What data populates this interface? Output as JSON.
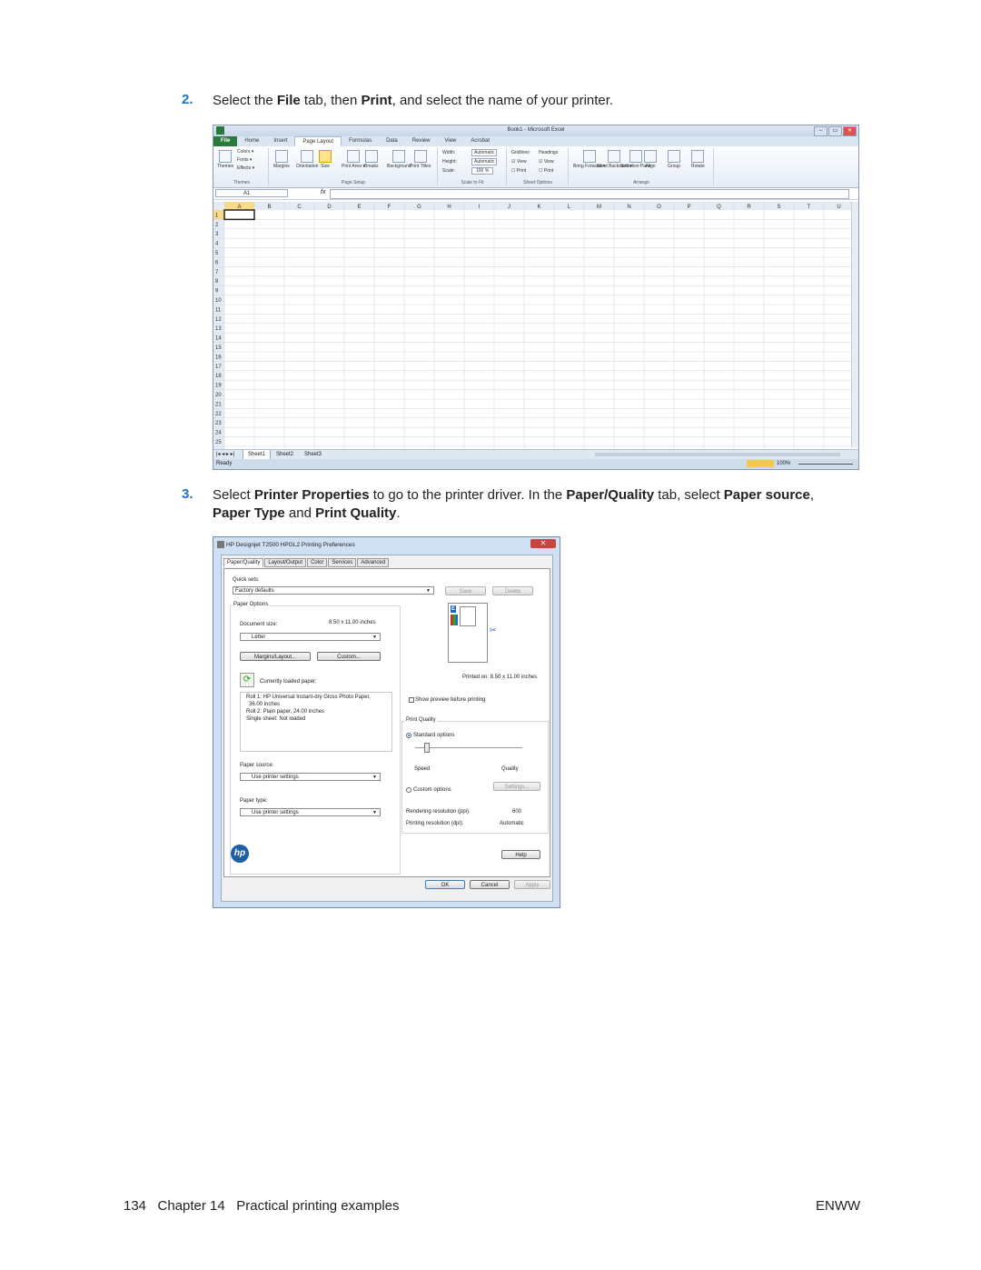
{
  "steps": [
    {
      "number": "2.",
      "segments": [
        {
          "text": "Select the ",
          "bold": false
        },
        {
          "text": "File",
          "bold": true
        },
        {
          "text": " tab, then ",
          "bold": false
        },
        {
          "text": "Print",
          "bold": true
        },
        {
          "text": ", and select the name of your printer.",
          "bold": false
        }
      ]
    },
    {
      "number": "3.",
      "segments": [
        {
          "text": "Select ",
          "bold": false
        },
        {
          "text": "Printer Properties",
          "bold": true
        },
        {
          "text": " to go to the printer driver. In the ",
          "bold": false
        },
        {
          "text": "Paper/Quality",
          "bold": true
        },
        {
          "text": " tab, select ",
          "bold": false
        },
        {
          "text": "Paper source",
          "bold": true
        },
        {
          "text": ",",
          "bold": false
        },
        {
          "text": "Paper Type",
          "bold": true,
          "newline": true
        },
        {
          "text": " and ",
          "bold": false
        },
        {
          "text": "Print Quality",
          "bold": true
        },
        {
          "text": ".",
          "bold": false
        }
      ]
    }
  ],
  "excel": {
    "title": "Book1 - Microsoft Excel",
    "window_buttons": [
      "–",
      "▭",
      "✕"
    ],
    "tabs": [
      "File",
      "Home",
      "Insert",
      "Page Layout",
      "Formulas",
      "Data",
      "Review",
      "View",
      "Acrobat"
    ],
    "ribbon": {
      "themes": {
        "items": [
          "Colors ▾",
          "Fonts ▾",
          "Effects ▾"
        ],
        "themes_label": "Themes",
        "group": "Themes"
      },
      "page_setup": {
        "items": [
          "Margins",
          "Orientation",
          "Size",
          "Print Area ▾",
          "Breaks",
          "Background",
          "Print Titles"
        ],
        "group": "Page Setup"
      },
      "scale": {
        "width_label": "Width:",
        "width_value": "Automatic",
        "height_label": "Height:",
        "height_value": "Automatic",
        "scale_label": "Scale:",
        "scale_value": "100 %",
        "group": "Scale to Fit"
      },
      "sheet_options": {
        "gridlines": "Gridlines",
        "headings": "Headings",
        "view": "View",
        "print": "Print",
        "group": "Sheet Options"
      },
      "arrange": {
        "items": [
          "Bring Forward ▾",
          "Send Backward ▾",
          "Selection Pane",
          "Align",
          "Group",
          "Rotate"
        ],
        "group": "Arrange"
      }
    },
    "name_box": "A1",
    "fx": "fx",
    "columns": [
      "A",
      "B",
      "C",
      "D",
      "E",
      "F",
      "G",
      "H",
      "I",
      "J",
      "K",
      "L",
      "M",
      "N",
      "O",
      "P",
      "Q",
      "R",
      "S",
      "T",
      "U"
    ],
    "rows": [
      "1",
      "2",
      "3",
      "4",
      "5",
      "6",
      "7",
      "8",
      "9",
      "10",
      "11",
      "12",
      "13",
      "14",
      "15",
      "16",
      "17",
      "18",
      "19",
      "20",
      "21",
      "22",
      "23",
      "24",
      "25"
    ],
    "sheets": [
      "Sheet1",
      "Sheet2",
      "Sheet3"
    ],
    "status": "Ready",
    "zoom": "100%"
  },
  "dialog": {
    "title": "HP Designjet T2500 HPGL2 Printing Preferences",
    "close": "✕",
    "tabs": [
      "Paper/Quality",
      "Layout/Output",
      "Color",
      "Services",
      "Advanced"
    ],
    "quick_sets_label": "Quick sets:",
    "quick_sets_value": "Factory defaults",
    "save": "Save",
    "delete": "Delete",
    "paper_options": "Paper Options",
    "document_size_label": "Document size:",
    "document_size_value": "8.50 x 11.00 inches",
    "document_size_select": "Letter",
    "margins_layout": "Margins/Layout...",
    "custom": "Custom...",
    "currently_loaded": "Currently loaded paper:",
    "loaded_lines": [
      "Roll 1: HP Universal Instant-dry Gloss Photo Paper,",
      "36.00 inches",
      "Roll 2: Plain paper, 24.00 inches",
      "Single sheet: Not loaded"
    ],
    "paper_source_label": "Paper source:",
    "paper_source_value": "Use printer settings",
    "paper_type_label": "Paper type:",
    "paper_type_value": "Use printer settings",
    "printed_on": "Printed on: 8.50 x 11.00 inches",
    "show_preview": "Show preview before printing",
    "print_quality": "Print Quality",
    "standard_options": "Standard options",
    "speed": "Speed",
    "quality": "Quality",
    "custom_options": "Custom options",
    "settings": "Settings...",
    "rendering_label": "Rendering resolution (ppi):",
    "rendering_value": "600",
    "printing_label": "Printing resolution (dpi):",
    "printing_value": "Automatic",
    "help": "Help",
    "ok": "OK",
    "cancel": "Cancel",
    "apply": "Apply",
    "logo": "hp"
  },
  "footer": {
    "left": "134   Chapter 14   Practical printing examples",
    "right": "ENWW"
  }
}
